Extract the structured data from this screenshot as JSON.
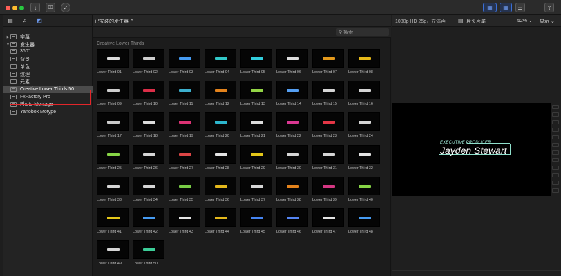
{
  "window": {
    "traffic_lights": {
      "close": "#ff5f57",
      "minimize": "#febc2e",
      "zoom": "#28c840"
    },
    "accent": "#3a6fd8"
  },
  "toolbar": {
    "import_icon": "↓",
    "keyword_icon": "⚿",
    "check_icon": "✓",
    "grid_icon_a": "▦",
    "grid_icon_b": "▦",
    "sliders_icon": "☰",
    "share_icon": "⇧"
  },
  "sidebar": {
    "tools": [
      "▤",
      "♫",
      "◩"
    ],
    "items": [
      {
        "label": "字幕",
        "arrow": "▶",
        "level": 0,
        "selected": false
      },
      {
        "label": "发生器",
        "arrow": "▼",
        "level": 0,
        "selected": false
      },
      {
        "label": "360°",
        "arrow": "",
        "level": 1,
        "selected": false
      },
      {
        "label": "背景",
        "arrow": "",
        "level": 1,
        "selected": false
      },
      {
        "label": "单色",
        "arrow": "",
        "level": 1,
        "selected": false
      },
      {
        "label": "纹理",
        "arrow": "",
        "level": 1,
        "selected": false
      },
      {
        "label": "元素",
        "arrow": "",
        "level": 1,
        "selected": false
      },
      {
        "label": "Creative Lower Thirds 50",
        "arrow": "",
        "level": 1,
        "selected": true
      },
      {
        "label": "FxFactory Pro",
        "arrow": "",
        "level": 1,
        "selected": false
      },
      {
        "label": "Photo Montage",
        "arrow": "",
        "level": 1,
        "selected": false
      },
      {
        "label": "Yanobox Motype",
        "arrow": "",
        "level": 1,
        "selected": false
      }
    ]
  },
  "browser": {
    "installed_label": "已安装的发生器",
    "installed_chevron": "⌃",
    "search_placeholder": "搜索",
    "search_icon": "⚲",
    "section_title": "Creative Lower Thirds",
    "tiles": [
      {
        "label": "Lower Third 01",
        "color": "#e8e8e8"
      },
      {
        "label": "Lower Third 02",
        "color": "#d9d9d9"
      },
      {
        "label": "Lower Third 03",
        "color": "#4aa3ff"
      },
      {
        "label": "Lower Third 04",
        "color": "#35d3d3"
      },
      {
        "label": "Lower Third 05",
        "color": "#35d9e9"
      },
      {
        "label": "Lower Third 06",
        "color": "#e9e9e9"
      },
      {
        "label": "Lower Third 07",
        "color": "#f0a21e"
      },
      {
        "label": "Lower Third 08",
        "color": "#f2c31a"
      },
      {
        "label": "Lower Third 09",
        "color": "#d8d8d8"
      },
      {
        "label": "Lower Third 10",
        "color": "#e8304c"
      },
      {
        "label": "Lower Third 11",
        "color": "#3fb8d8"
      },
      {
        "label": "Lower Third 12",
        "color": "#f08a1e"
      },
      {
        "label": "Lower Third 13",
        "color": "#9be04a"
      },
      {
        "label": "Lower Third 14",
        "color": "#5aa8ff"
      },
      {
        "label": "Lower Third 15",
        "color": "#e0e0e0"
      },
      {
        "label": "Lower Third 16",
        "color": "#e0e0e0"
      },
      {
        "label": "Lower Third 17",
        "color": "#d5d5d5"
      },
      {
        "label": "Lower Third 18",
        "color": "#e8e8e8"
      },
      {
        "label": "Lower Third 19",
        "color": "#e8357a"
      },
      {
        "label": "Lower Third 20",
        "color": "#2fc0d8"
      },
      {
        "label": "Lower Third 21",
        "color": "#e8e8e8"
      },
      {
        "label": "Lower Third 22",
        "color": "#e63a9a"
      },
      {
        "label": "Lower Third 23",
        "color": "#f0394a"
      },
      {
        "label": "Lower Third 24",
        "color": "#e0e0e0"
      },
      {
        "label": "Lower Third 25",
        "color": "#8ee04a"
      },
      {
        "label": "Lower Third 26",
        "color": "#e0e0e0"
      },
      {
        "label": "Lower Third 27",
        "color": "#e84a4a"
      },
      {
        "label": "Lower Third 28",
        "color": "#f0f0f0"
      },
      {
        "label": "Lower Third 29",
        "color": "#f0d21a"
      },
      {
        "label": "Lower Third 30",
        "color": "#e0e0e0"
      },
      {
        "label": "Lower Third 31",
        "color": "#e0e0e0"
      },
      {
        "label": "Lower Third 32",
        "color": "#f0f0f0"
      },
      {
        "label": "Lower Third 33",
        "color": "#e0e0e0"
      },
      {
        "label": "Lower Third 34",
        "color": "#e0e0e0"
      },
      {
        "label": "Lower Third 35",
        "color": "#7fd84a"
      },
      {
        "label": "Lower Third 36",
        "color": "#f0c21e"
      },
      {
        "label": "Lower Third 37",
        "color": "#e0e0e0"
      },
      {
        "label": "Lower Third 38",
        "color": "#f08a1e"
      },
      {
        "label": "Lower Third 39",
        "color": "#e03a8a"
      },
      {
        "label": "Lower Third 40",
        "color": "#8ee04a"
      },
      {
        "label": "Lower Third 41",
        "color": "#f0d21a"
      },
      {
        "label": "Lower Third 42",
        "color": "#4aa3ff"
      },
      {
        "label": "Lower Third 43",
        "color": "#f0f0f0"
      },
      {
        "label": "Lower Third 44",
        "color": "#f0c21e"
      },
      {
        "label": "Lower Third 45",
        "color": "#4a8cff"
      },
      {
        "label": "Lower Third 46",
        "color": "#5a8cff"
      },
      {
        "label": "Lower Third 47",
        "color": "#f0f0f0"
      },
      {
        "label": "Lower Third 48",
        "color": "#4aa3ff"
      },
      {
        "label": "Lower Third 49",
        "color": "#e0e0e0"
      },
      {
        "label": "Lower Third 50",
        "color": "#3fd8a0"
      }
    ]
  },
  "viewer": {
    "format_label": "1080p HD 25p，立体声",
    "clip_icon": "▤",
    "clip_name": "片头片尾",
    "zoom_label": "52% ⌄",
    "display_label": "显示 ⌄",
    "title_small": "EXECUTIVE PRODUCER",
    "title_big": "Jayden Stewart",
    "title_accent": "#8fe0cc"
  }
}
